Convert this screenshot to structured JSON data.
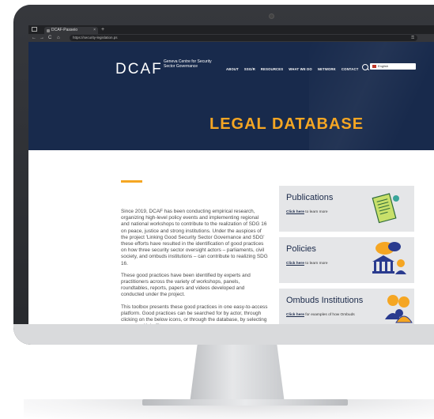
{
  "browser": {
    "tab_title": "DCAF-Passeio",
    "tab_close": "×",
    "new_tab": "+",
    "url": "https://security-legislation.ps",
    "back": "←",
    "forward": "→",
    "reload": "C",
    "home": "⌂",
    "info": "ⓘ",
    "key_icon": "⚿"
  },
  "site": {
    "logo": "DCAF",
    "logo_sub": "Geneva Centre for Security Sector Governance",
    "menu": [
      "ABOUT",
      "SSG/R",
      "RESOURCES",
      "WHAT WE DO",
      "NETWORK",
      "CONTACT"
    ],
    "language": "English",
    "page_title": "LEGAL DATABASE",
    "accent_color": "#f5a623",
    "navy": "#182a4c"
  },
  "intro": [
    "Since 2019, DCAF has been conducting empirical research, organizing high-level policy events and implementing regional and national workshops to contribute to the realization of SDG 16 on peace, justice and strong institutions. Under the auspices of the project 'Linking Good Security Sector Governance and SDG' these efforts have resulted in the identification of good practices on how three security sector oversight actors – parliaments, civil society, and ombuds institutions – can contribute to realizing SDG 16.",
    "These good practices have been identified by experts and practitioners across the variety of workshops, panels, roundtables, reports, papers and videos developed and conducted under the project.",
    "This toolbox presents these good practices in one easy-to-access platform. Good practices can be searched for by actor, through clicking on the below icons, or through the database, by selecting one or multiple filters."
  ],
  "cards": [
    {
      "title": "Publications",
      "link": "Click here",
      "suffix": " to learn more",
      "icon": "document-icon"
    },
    {
      "title": "Policies",
      "link": "Click here",
      "suffix": " to learn more",
      "icon": "institution-icon"
    },
    {
      "title": "Ombuds Institutions",
      "link": "Click here",
      "suffix": " for examples of how Ombuds",
      "icon": "people-icon"
    }
  ]
}
